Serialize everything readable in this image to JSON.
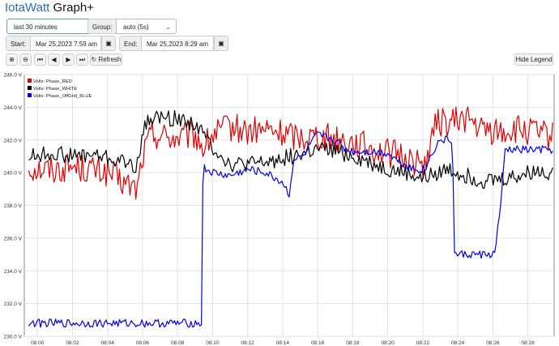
{
  "app": {
    "brand": "IotaWatt",
    "title_rest": " Graph+"
  },
  "controls": {
    "range_value": "last 30 minutes",
    "group_label": "Group:",
    "group_value": "auto (5s)",
    "start_label": "Start:",
    "start_value": "Mar 25,2023 7:59 am",
    "end_label": "End:",
    "end_value": "Mar 25,2023 8:29 am",
    "refresh_label": "Refresh",
    "hide_legend_label": "Hide Legend"
  },
  "icons": {
    "zoom_in": "zoom-in-icon",
    "zoom_out": "zoom-out-icon",
    "first": "skip-back-icon",
    "prev": "step-back-icon",
    "next": "step-forward-icon",
    "last": "skip-forward-icon",
    "refresh": "refresh-icon",
    "calendar": "calendar-icon"
  },
  "chart_data": {
    "type": "line",
    "x_start_min": 0,
    "x_end_min": 30,
    "xticks": [
      "08:00",
      "08:02",
      "08:04",
      "08:06",
      "08:08",
      "08:10",
      "08:12",
      "08:14",
      "08:16",
      "08:18",
      "08:20",
      "08:22",
      "08:24",
      "08:26",
      "08:28"
    ],
    "ylim": [
      230,
      246
    ],
    "yticks": [
      "230.0 V",
      "232.0 V",
      "234.0 V",
      "236.0 V",
      "238.0 V",
      "240.0 V",
      "242.0 V",
      "244.0 V",
      "246.0 V"
    ],
    "grid": true,
    "legend_position": "top-left",
    "series": [
      {
        "name": "Volts: Phase_RED",
        "color": "#e00000",
        "anchors": [
          [
            -0.5,
            240.3
          ],
          [
            1,
            240.2
          ],
          [
            2,
            240.4
          ],
          [
            3,
            240.2
          ],
          [
            4,
            240.0
          ],
          [
            5,
            239.3
          ],
          [
            5.7,
            239.0
          ],
          [
            6.0,
            241.0
          ],
          [
            6.5,
            242.4
          ],
          [
            8,
            242.1
          ],
          [
            9,
            242.3
          ],
          [
            9.5,
            241.5
          ],
          [
            10,
            242.3
          ],
          [
            11,
            242.8
          ],
          [
            12,
            242.5
          ],
          [
            13,
            242.6
          ],
          [
            14,
            242.4
          ],
          [
            15,
            242.2
          ],
          [
            16,
            242.3
          ],
          [
            17,
            242.1
          ],
          [
            18,
            241.9
          ],
          [
            19,
            241.5
          ],
          [
            20,
            241.2
          ],
          [
            21,
            241.0
          ],
          [
            22,
            240.4
          ],
          [
            22.4,
            241.4
          ],
          [
            22.8,
            243.2
          ],
          [
            23.5,
            243.0
          ],
          [
            24.5,
            243.4
          ],
          [
            25.3,
            242.6
          ],
          [
            26.5,
            242.5
          ],
          [
            27.5,
            242.6
          ],
          [
            28.5,
            242.4
          ],
          [
            29.3,
            242.2
          ]
        ],
        "noise": 0.9
      },
      {
        "name": "Volts: Phase_WHITE",
        "color": "#000000",
        "anchors": [
          [
            -0.5,
            241.0
          ],
          [
            1,
            241.2
          ],
          [
            2,
            241.0
          ],
          [
            3,
            241.1
          ],
          [
            4,
            240.9
          ],
          [
            5,
            240.6
          ],
          [
            5.7,
            240.4
          ],
          [
            6.0,
            242.5
          ],
          [
            6.5,
            243.4
          ],
          [
            8,
            243.3
          ],
          [
            9,
            243.0
          ],
          [
            9.5,
            242.3
          ],
          [
            10,
            241.6
          ],
          [
            11,
            240.5
          ],
          [
            12,
            240.5
          ],
          [
            13,
            240.6
          ],
          [
            14,
            240.9
          ],
          [
            15,
            241.1
          ],
          [
            16,
            241.4
          ],
          [
            17,
            241.3
          ],
          [
            18,
            241.0
          ],
          [
            19,
            240.6
          ],
          [
            20,
            240.2
          ],
          [
            21,
            240.0
          ],
          [
            22,
            239.6
          ],
          [
            22.8,
            240.0
          ],
          [
            23.5,
            240.2
          ],
          [
            24.5,
            239.8
          ],
          [
            25.5,
            239.5
          ],
          [
            26.5,
            239.6
          ],
          [
            27.5,
            239.8
          ],
          [
            28.5,
            240.1
          ],
          [
            29.3,
            240.0
          ]
        ],
        "noise": 0.5
      },
      {
        "name": "Volts: Phase_OffGrid_BLUE",
        "color": "#0000ee",
        "anchors": [
          [
            -0.5,
            230.8
          ],
          [
            3,
            230.8
          ],
          [
            6,
            230.8
          ],
          [
            9.4,
            230.8
          ],
          [
            9.45,
            240.3
          ],
          [
            10,
            240.0
          ],
          [
            11,
            239.8
          ],
          [
            12,
            240.2
          ],
          [
            13,
            240.0
          ],
          [
            14,
            239.4
          ],
          [
            14.4,
            238.6
          ],
          [
            14.6,
            240.8
          ],
          [
            15.2,
            241.0
          ],
          [
            15.6,
            241.8
          ],
          [
            16,
            242.3
          ],
          [
            17,
            242.0
          ],
          [
            17.5,
            241.5
          ],
          [
            18,
            241.3
          ],
          [
            19,
            241.3
          ],
          [
            20,
            241.2
          ],
          [
            20.5,
            240.8
          ],
          [
            21,
            240.5
          ],
          [
            21.5,
            240.2
          ],
          [
            22,
            240.2
          ],
          [
            22.2,
            240.3
          ],
          [
            22.5,
            241.2
          ],
          [
            23,
            242.0
          ],
          [
            23.7,
            242.0
          ],
          [
            23.8,
            235.0
          ],
          [
            24.5,
            235.0
          ],
          [
            26.1,
            235.0
          ],
          [
            26.5,
            238.5
          ],
          [
            26.7,
            241.4
          ],
          [
            28,
            241.4
          ],
          [
            29.3,
            241.4
          ]
        ],
        "noise": 0.25
      }
    ]
  }
}
